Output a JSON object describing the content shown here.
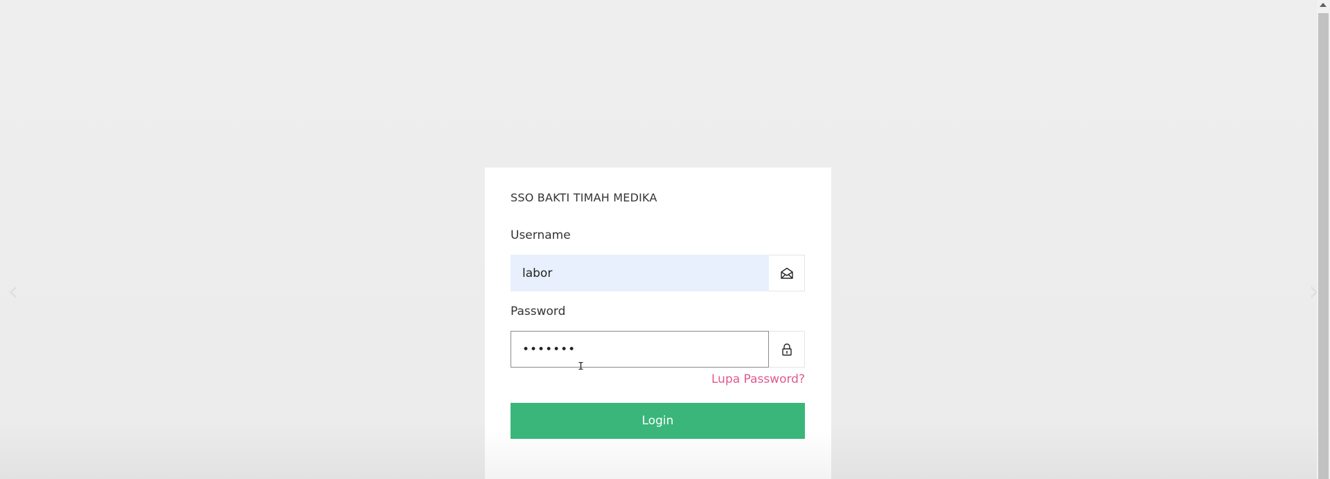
{
  "carousel": {
    "prev_glyph": "‹",
    "next_glyph": "›"
  },
  "login_card": {
    "brand_title": "SSO BAKTI TIMAH MEDIKA",
    "username": {
      "label": "Username",
      "value": "labor",
      "icon": "envelope-icon"
    },
    "password": {
      "label": "Password",
      "masked_value": "•••••••",
      "icon": "lock-icon"
    },
    "forgot_password_label": "Lupa Password?",
    "login_label": "Login"
  },
  "colors": {
    "page_background": "#ededed",
    "username_autofill": "#e8f0fe",
    "forgot_link": "#e0588c",
    "login_button": "#3ab67a"
  },
  "icons": {
    "cursor": "text-cursor-icon"
  }
}
